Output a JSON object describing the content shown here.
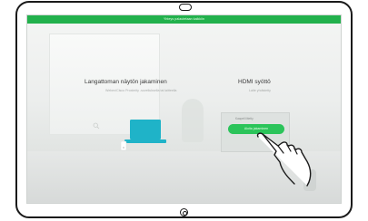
{
  "banner": {
    "text": "Yhteys palautetaan kaikkiin"
  },
  "wireless": {
    "title": "Langattoman näytön jakaminen",
    "subtitle": "Webex/Cisco Proximity -sovelluksella tai laitteella"
  },
  "hdmi": {
    "title": "HDMI syöttö",
    "subtitle": "Laite yhdistetty",
    "box_label": "Kaapeli liitetty",
    "start_label": "Aloita jakaminen"
  },
  "icons": {
    "search": "search-icon",
    "laptop": "laptop-icon",
    "hand": "hand-pointer-icon",
    "camera": "camera-icon",
    "home": "home-button-icon"
  },
  "colors": {
    "accent": "#22b14c",
    "laptop": "#1fb3c8"
  }
}
